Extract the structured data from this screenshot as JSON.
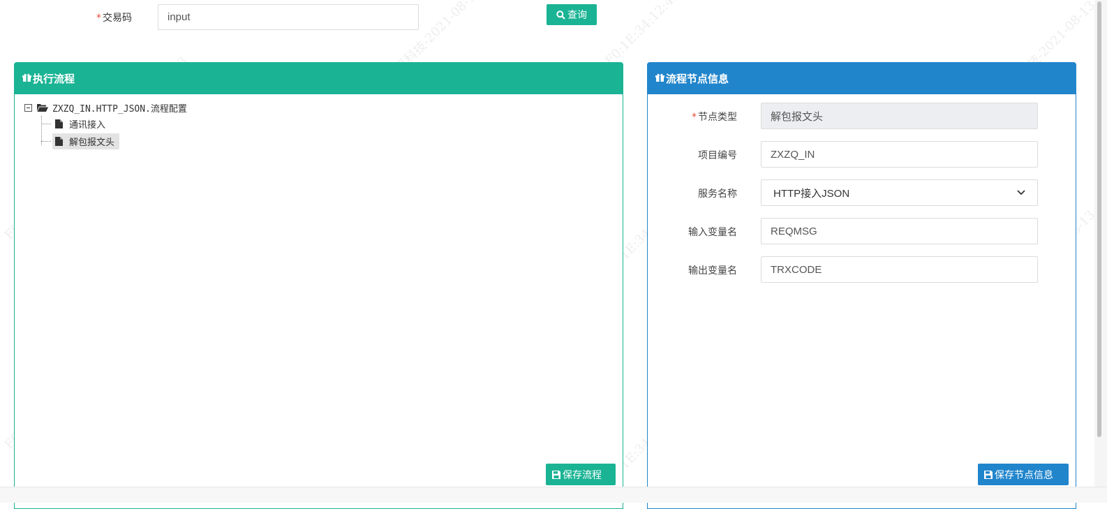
{
  "search": {
    "label": "交易码",
    "required_mark": "*",
    "value": "input",
    "query_button": "查询"
  },
  "left_panel": {
    "title": "执行流程",
    "tree": {
      "root": "ZXZQ_IN.HTTP_JSON.流程配置",
      "children": [
        "通讯接入",
        "解包报文头"
      ],
      "selected": "解包报文头"
    },
    "save_button": "保存流程"
  },
  "right_panel": {
    "title": "流程节点信息",
    "fields": {
      "node_type": {
        "label": "节点类型",
        "value": "解包报文头"
      },
      "project_code": {
        "label": "项目编号",
        "value": "ZXZQ_IN"
      },
      "service_name": {
        "label": "服务名称",
        "value": "HTTP接入JSON"
      },
      "input_var": {
        "label": "输入变量名",
        "value": "REQMSG"
      },
      "output_var": {
        "label": "输出变量名",
        "value": "TRXCODE"
      }
    },
    "save_button": "保存节点信息"
  },
  "watermark": "F0:1E:34:12:4D:30-银雁科技-2021-08-13",
  "colors": {
    "green": "#1ab394",
    "blue": "#2185cc",
    "required": "#e74c3c"
  },
  "icons": {
    "query": "search-icon",
    "panel_header": "gift-icon",
    "tree_root": "folder-open-icon",
    "tree_leaf": "file-icon",
    "save": "floppy-disk-icon",
    "select": "chevron-down-icon"
  }
}
